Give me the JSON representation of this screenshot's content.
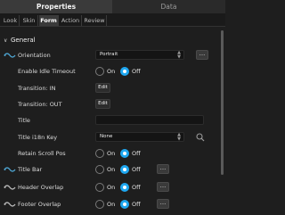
{
  "top_tabs": [
    "Properties",
    "Data"
  ],
  "sub_tabs": [
    "Look",
    "Skin",
    "Form",
    "Action",
    "Review"
  ],
  "active_sub_tab": "Form",
  "section": {
    "title": "General",
    "expanded": true
  },
  "rows": {
    "orientation": {
      "label": "Orientation",
      "value": "Portrait",
      "more": "..."
    },
    "idle_timeout": {
      "label": "Enable Idle Timeout",
      "on": "On",
      "off": "Off",
      "selected": "Off"
    },
    "transition_in": {
      "label": "Transition: IN",
      "button": "Edit"
    },
    "transition_out": {
      "label": "Transition: OUT",
      "button": "Edit"
    },
    "title": {
      "label": "Title",
      "value": ""
    },
    "title_i18n": {
      "label": "Title i18n Key",
      "value": "None"
    },
    "retain_scroll": {
      "label": "Retain Scroll Pos",
      "on": "On",
      "off": "Off",
      "selected": "Off"
    },
    "title_bar": {
      "label": "Title Bar",
      "on": "On",
      "off": "Off",
      "selected": "Off",
      "more": "..."
    },
    "header_overlap": {
      "label": "Header Overlap",
      "on": "On",
      "off": "Off",
      "selected": "Off",
      "more": "..."
    },
    "footer_overlap": {
      "label": "Footer Overlap",
      "on": "On",
      "off": "Off",
      "selected": "Off",
      "more": "..."
    }
  },
  "colors": {
    "accent": "#1ea7f0",
    "background": "#1e1e1e"
  }
}
